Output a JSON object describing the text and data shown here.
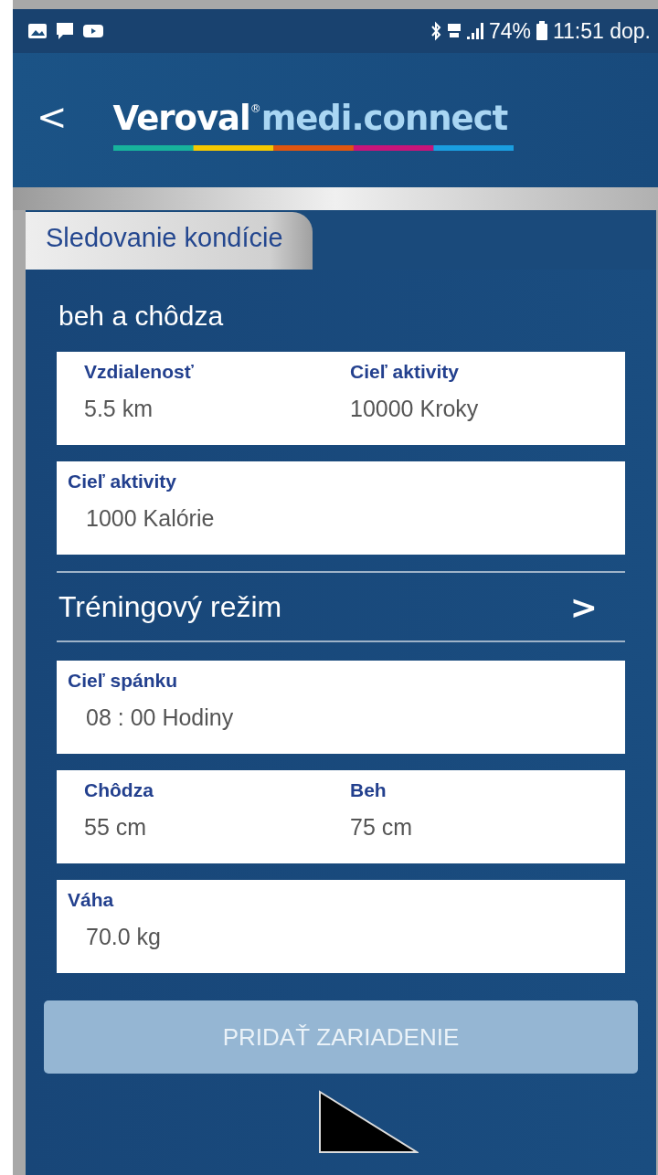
{
  "status_bar": {
    "battery": "74%",
    "time": "11:51 dop."
  },
  "header": {
    "logo_brand": "Veroval",
    "logo_mark": "®",
    "logo_product": "medi.connect",
    "back": "<"
  },
  "tab": {
    "label": "Sledovanie kondície",
    "selected": true
  },
  "section_title": "beh a chôdza",
  "cards_top": [
    {
      "fields": [
        {
          "label": "Vzdialenosť",
          "value": "5.5 km"
        },
        {
          "label": "Cieľ aktivity",
          "value": "10000 Kroky"
        }
      ]
    },
    {
      "fields": [
        {
          "label": "Cieľ aktivity",
          "value": "1000 Kalórie"
        }
      ]
    }
  ],
  "training": {
    "label": "Tréningový režim",
    "chevron": ">"
  },
  "cards_bottom": [
    {
      "fields": [
        {
          "label": "Cieľ spánku",
          "value": "08 : 00 Hodiny"
        }
      ]
    },
    {
      "fields": [
        {
          "label": "Chôdza",
          "value": "55 cm"
        },
        {
          "label": "Beh",
          "value": "75 cm"
        }
      ]
    },
    {
      "fields": [
        {
          "label": "Váha",
          "value": "70.0 kg"
        }
      ]
    }
  ],
  "button": {
    "label": "PRIDAŤ ZARIADENIE",
    "disabled": true
  }
}
